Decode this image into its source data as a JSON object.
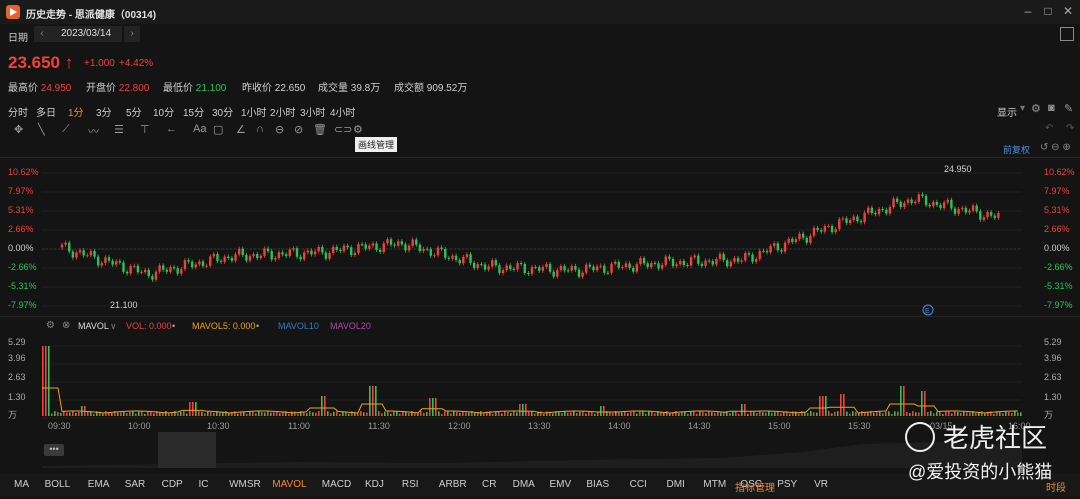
{
  "window": {
    "title": "历史走势 - 思派健康（00314)"
  },
  "datebar": {
    "label": "日期",
    "prev": "‹",
    "date": "2023/03/14",
    "next": "›"
  },
  "quote": {
    "price": "23.650",
    "change": "+1.000",
    "change_pct": "+4.42%",
    "high_label": "最高价",
    "high": "24.950",
    "open_label": "开盘价",
    "open": "22.800",
    "low_label": "最低价",
    "low": "21.100",
    "prevclose_label": "昨收价",
    "prevclose": "22.650",
    "volume_label": "成交量",
    "volume": "39.8万",
    "turnover_label": "成交额",
    "turnover": "909.52万"
  },
  "period_tabs": [
    "分时",
    "多日",
    "1分",
    "3分",
    "5分",
    "10分",
    "15分",
    "30分",
    "1小时",
    "2小时",
    "3小时",
    "4小时"
  ],
  "active_period": "1分",
  "right_controls": {
    "display": "显示",
    "adjust": "前复权"
  },
  "tooltip": "画线管理",
  "price_axis": [
    "10.62%",
    "7.97%",
    "5.31%",
    "2.66%",
    "0.00%",
    "-2.66%",
    "-5.31%",
    "-7.97%"
  ],
  "annotations": {
    "high": "24.950",
    "low": "21.100",
    "event": "E"
  },
  "volume_panel": {
    "name": "MAVOL",
    "vol": "VOL: 0.000",
    "mavol5": "MAVOL5: 0.000",
    "mavol10": "MAVOL10",
    "mavol20": "MAVOL20",
    "axis": [
      "5.29",
      "3.96",
      "2.63",
      "1.30",
      "万"
    ]
  },
  "time_axis": [
    "09:30",
    "10:00",
    "10:30",
    "11:00",
    "11:30",
    "12:00",
    "13:30",
    "14:00",
    "14:30",
    "15:00",
    "15:30",
    "03/15",
    "16:00"
  ],
  "indicators": [
    "MA",
    "BOLL",
    "EMA",
    "SAR",
    "CDP",
    "IC",
    "WMSR",
    "MAVOL",
    "MACD",
    "KDJ",
    "RSI",
    "ARBR",
    "CR",
    "DMA",
    "EMV",
    "BIAS",
    "CCI",
    "DMI",
    "MTM",
    "OSC",
    "PSY",
    "VR"
  ],
  "active_indicator": "MAVOL",
  "indicator_manage": "指标管理",
  "period_label": "时段",
  "watermark": {
    "brand": "老虎社区",
    "user": "@爱投资的小熊猫"
  },
  "colors": {
    "up": "#f0413b",
    "down": "#2ec05a",
    "accent": "#f08a2b",
    "mavol5": "#f0a020",
    "mavol10": "#3a78c4",
    "mavol20": "#b04aa0"
  },
  "chart_data": {
    "type": "candlestick",
    "ylabel": "change %",
    "ylim": [
      -7.97,
      10.62
    ],
    "x": [
      "09:30",
      "10:00",
      "10:30",
      "11:00",
      "11:30",
      "12:00",
      "13:30",
      "14:00",
      "14:30",
      "15:00",
      "15:30",
      "16:00"
    ],
    "close_pct": [
      0.2,
      -3.5,
      -1.0,
      -0.5,
      0.8,
      -2.5,
      -3.0,
      -2.0,
      -1.5,
      3.0,
      7.0,
      4.42
    ]
  }
}
